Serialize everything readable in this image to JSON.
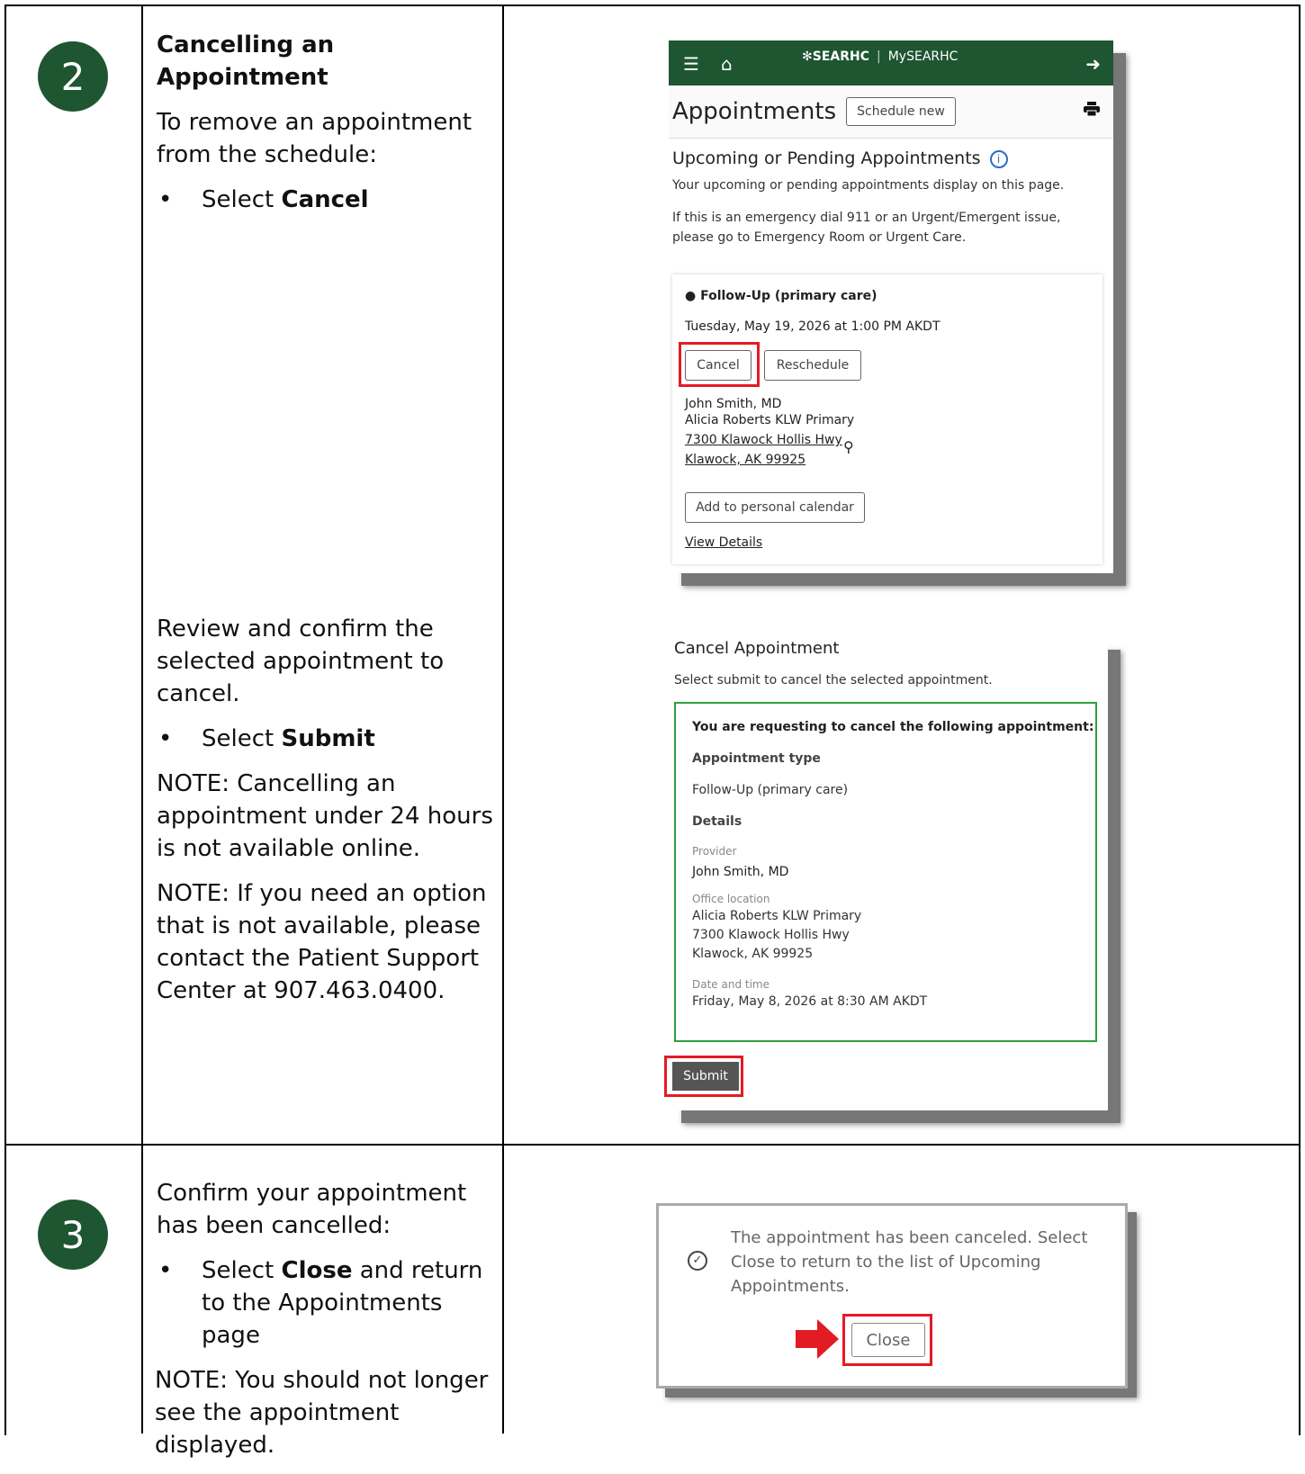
{
  "step2": {
    "number": "2",
    "heading": "Cancelling an Appointment",
    "intro": "To remove an appointment from the schedule:",
    "bullet1_pre": "Select ",
    "bullet1_bold": "Cancel",
    "review": "Review and confirm the selected appointment to cancel.",
    "bullet2_pre": "Select ",
    "bullet2_bold": "Submit",
    "note1": "NOTE: Cancelling an appointment under 24 hours is not available online.",
    "note2": "NOTE: If you need an option that is not available, please contact the Patient Support Center at 907.463.0400."
  },
  "step3": {
    "number": "3",
    "intro": "Confirm your appointment has been cancelled:",
    "bullet_pre": "Select ",
    "bullet_bold": "Close",
    "bullet_post": " and return to the Appointments page",
    "note": "NOTE: You should not longer see the appointment displayed."
  },
  "shot1": {
    "brand": "SEARHC",
    "brand2": "MySEARHC",
    "title": "Appointments",
    "schedule_new": "Schedule new",
    "section_title": "Upcoming or Pending Appointments",
    "desc": "Your upcoming or pending appointments display on this page.",
    "emergency": "If this is an emergency dial 911 or an Urgent/Emergent issue, please go to Emergency Room or Urgent Care.",
    "appt_type": "Follow-Up (primary care)",
    "datetime": "Tuesday, May 19, 2026 at 1:00 PM AKDT",
    "cancel": "Cancel",
    "reschedule": "Reschedule",
    "provider": "John Smith, MD",
    "clinic": "Alicia Roberts KLW Primary",
    "address1": "7300 Klawock Hollis Hwy",
    "address2": "Klawock, AK 99925",
    "add_calendar": "Add to personal calendar",
    "view_details": "View Details"
  },
  "shot2": {
    "title": "Cancel Appointment",
    "sub": "Select submit to cancel the selected appointment.",
    "requesting": "You are requesting to cancel the following appointment:",
    "type_label": "Appointment type",
    "type_value": "Follow-Up (primary care)",
    "details_label": "Details",
    "provider_label": "Provider",
    "provider": "John Smith, MD",
    "office_label": "Office location",
    "clinic": "Alicia Roberts KLW Primary",
    "address1": "7300 Klawock Hollis Hwy",
    "address2": "Klawock, AK 99925",
    "date_label": "Date and time",
    "datetime": "Friday, May 8, 2026 at 8:30 AM AKDT",
    "submit": "Submit"
  },
  "shot3": {
    "message": "The appointment has been canceled. Select Close to return to the list of Upcoming Appointments.",
    "close": "Close"
  },
  "colors": {
    "brand_green": "#1e5631",
    "highlight_red": "#e31b23",
    "confirm_green": "#2e9e3e",
    "link_blue": "#1a5fb4"
  }
}
